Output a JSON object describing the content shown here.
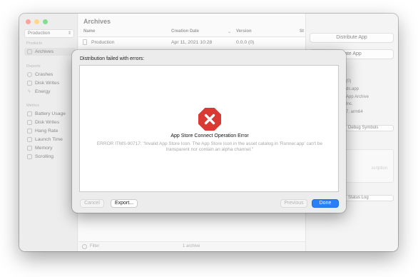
{
  "window": {
    "title": "Archives",
    "traffic_lights": [
      "close",
      "minimize",
      "zoom"
    ]
  },
  "sidebar": {
    "scheme_label": "Production",
    "sections": {
      "products": "Products",
      "reports": "Reports",
      "metrics": "Metrics"
    },
    "products_items": [
      {
        "label": "Archives",
        "icon": "archive-icon",
        "selected": true
      }
    ],
    "reports_items": [
      {
        "label": "Crashes",
        "icon": "crash-icon"
      },
      {
        "label": "Disk Writes",
        "icon": "disk-icon"
      },
      {
        "label": "Energy",
        "icon": "energy-icon"
      }
    ],
    "metrics_items": [
      {
        "label": "Battery Usage",
        "icon": "battery-icon"
      },
      {
        "label": "Disk Writes",
        "icon": "disk-icon"
      },
      {
        "label": "Hang Rate",
        "icon": "hang-icon"
      },
      {
        "label": "Launch Time",
        "icon": "launch-icon"
      },
      {
        "label": "Memory",
        "icon": "memory-icon"
      },
      {
        "label": "Scrolling",
        "icon": "scroll-icon"
      }
    ]
  },
  "table": {
    "columns": [
      "Name",
      "Creation Date",
      "Version",
      "St"
    ],
    "rows": [
      {
        "name": "Production",
        "date": "Apr 11, 2021 10:28",
        "version": "0.0.0 (0)"
      }
    ],
    "footer_filter": "Filter",
    "footer_count": "1 archive"
  },
  "inspector": {
    "distribute_label": "Distribute App",
    "validate_label": "date App",
    "values": [
      "(0)",
      "ds.app",
      "App Archive",
      "Inc.",
      "7, arm64"
    ],
    "debug_symbols_label": "Debug Symbols",
    "description_placeholder": "scription",
    "status_log_label": "Status Log"
  },
  "dialog": {
    "title": "Distribution failed with errors:",
    "error_title": "App Store Connect Operation Error",
    "error_message": "ERROR ITMS-90717: \"Invalid App Store Icon. The App Store Icon in the asset catalog in 'Runner.app' can't be transparent nor contain an alpha channel.\"",
    "buttons": {
      "cancel": "Cancel",
      "export": "Export...",
      "previous": "Previous",
      "done": "Done"
    }
  },
  "colors": {
    "accent": "#2a7ff5",
    "error_red": "#d93a34"
  }
}
